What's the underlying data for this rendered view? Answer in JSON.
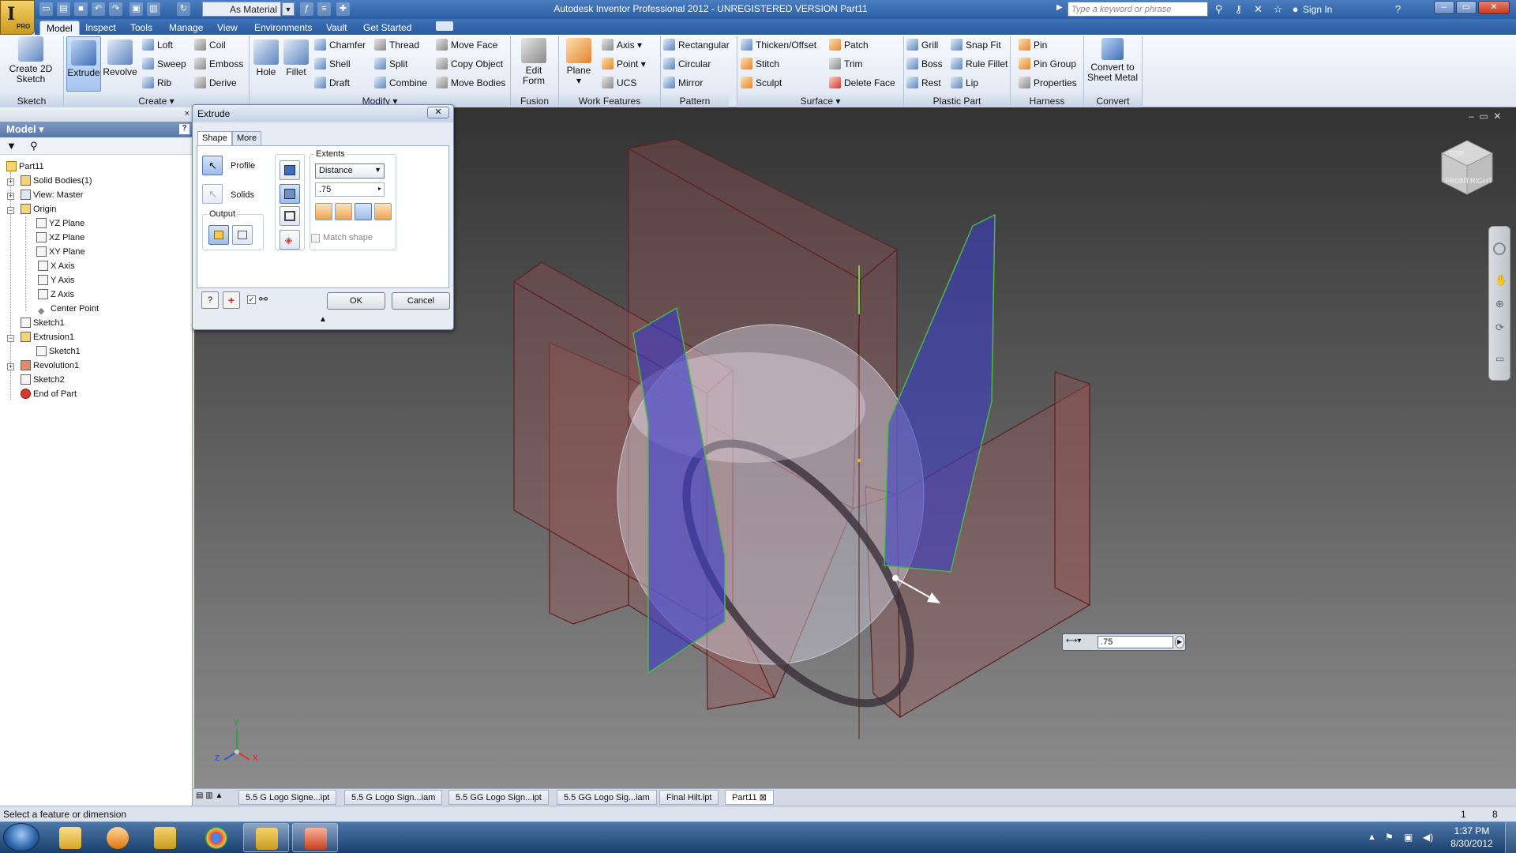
{
  "title_bar": {
    "window_title": "Autodesk Inventor Professional 2012 - UNREGISTERED VERSION    Part11",
    "material": "As Material",
    "search_placeholder": "Type a keyword or phrase",
    "sign_in": "Sign In",
    "app_badge": "PRO",
    "app_letter": "I"
  },
  "menu_tabs": [
    "Model",
    "Inspect",
    "Tools",
    "Manage",
    "View",
    "Environments",
    "Vault",
    "Get Started"
  ],
  "ribbon": {
    "sketch": {
      "create_2d_sketch": "Create 2D Sketch",
      "label": "Sketch"
    },
    "create": {
      "extrude": "Extrude",
      "revolve": "Revolve",
      "loft": "Loft",
      "sweep": "Sweep",
      "rib": "Rib",
      "coil": "Coil",
      "emboss": "Emboss",
      "derive": "Derive",
      "label": "Create"
    },
    "modify": {
      "hole": "Hole",
      "fillet": "Fillet",
      "chamfer": "Chamfer",
      "shell": "Shell",
      "draft": "Draft",
      "thread": "Thread",
      "split": "Split",
      "combine": "Combine",
      "move_face": "Move Face",
      "copy_object": "Copy Object",
      "move_bodies": "Move Bodies",
      "label": "Modify"
    },
    "fusion": {
      "edit_form": "Edit Form",
      "label": "Fusion"
    },
    "work_features": {
      "plane": "Plane",
      "axis": "Axis",
      "point": "Point",
      "ucs": "UCS",
      "label": "Work Features"
    },
    "pattern": {
      "rectangular": "Rectangular",
      "circular": "Circular",
      "mirror": "Mirror",
      "label": "Pattern"
    },
    "surface": {
      "thicken_offset": "Thicken/Offset",
      "stitch": "Stitch",
      "sculpt": "Sculpt",
      "patch": "Patch",
      "trim": "Trim",
      "delete_face": "Delete Face",
      "label": "Surface"
    },
    "plastic_part": {
      "grill": "Grill",
      "boss": "Boss",
      "rest": "Rest",
      "snap_fit": "Snap Fit",
      "rule_fillet": "Rule Fillet",
      "lip": "Lip",
      "label": "Plastic Part"
    },
    "harness": {
      "pin": "Pin",
      "pin_group": "Pin Group",
      "properties": "Properties",
      "label": "Harness"
    },
    "convert": {
      "convert_to_sheet_metal": "Convert to Sheet Metal",
      "label": "Convert"
    }
  },
  "browser": {
    "header": "Model",
    "items": [
      {
        "label": "Part11"
      },
      {
        "label": "Solid Bodies(1)"
      },
      {
        "label": "View: Master"
      },
      {
        "label": "Origin"
      },
      {
        "label": "YZ Plane"
      },
      {
        "label": "XZ Plane"
      },
      {
        "label": "XY Plane"
      },
      {
        "label": "X Axis"
      },
      {
        "label": "Y Axis"
      },
      {
        "label": "Z Axis"
      },
      {
        "label": "Center Point"
      },
      {
        "label": "Sketch1"
      },
      {
        "label": "Extrusion1"
      },
      {
        "label": "Sketch1"
      },
      {
        "label": "Revolution1"
      },
      {
        "label": "Sketch2"
      },
      {
        "label": "End of Part"
      }
    ]
  },
  "dialog": {
    "title": "Extrude",
    "tabs": [
      "Shape",
      "More"
    ],
    "profile": "Profile",
    "solids": "Solids",
    "output": "Output",
    "extents": "Extents",
    "extents_value": "Distance",
    "distance_value": ".75",
    "match_shape": "Match shape",
    "ok": "OK",
    "cancel": "Cancel"
  },
  "viewport": {
    "dimension_value": ".75",
    "axis_x": "X",
    "axis_y": "Y",
    "axis_z": "Z",
    "viewcube_front": "FRONT",
    "viewcube_right": "RIGHT",
    "viewcube_top": "TOP"
  },
  "file_tabs": [
    "5.5 G Logo Signe...ipt",
    "5.5 G Logo Sign...iam",
    "5.5 GG Logo Sign...ipt",
    "5.5 GG Logo Sig...iam",
    "Final Hilt.ipt",
    "Part11"
  ],
  "status": {
    "message": "Select a feature or dimension",
    "count_a": "1",
    "count_b": "8"
  },
  "taskbar": {
    "time": "1:37 PM",
    "date": "8/30/2012"
  }
}
